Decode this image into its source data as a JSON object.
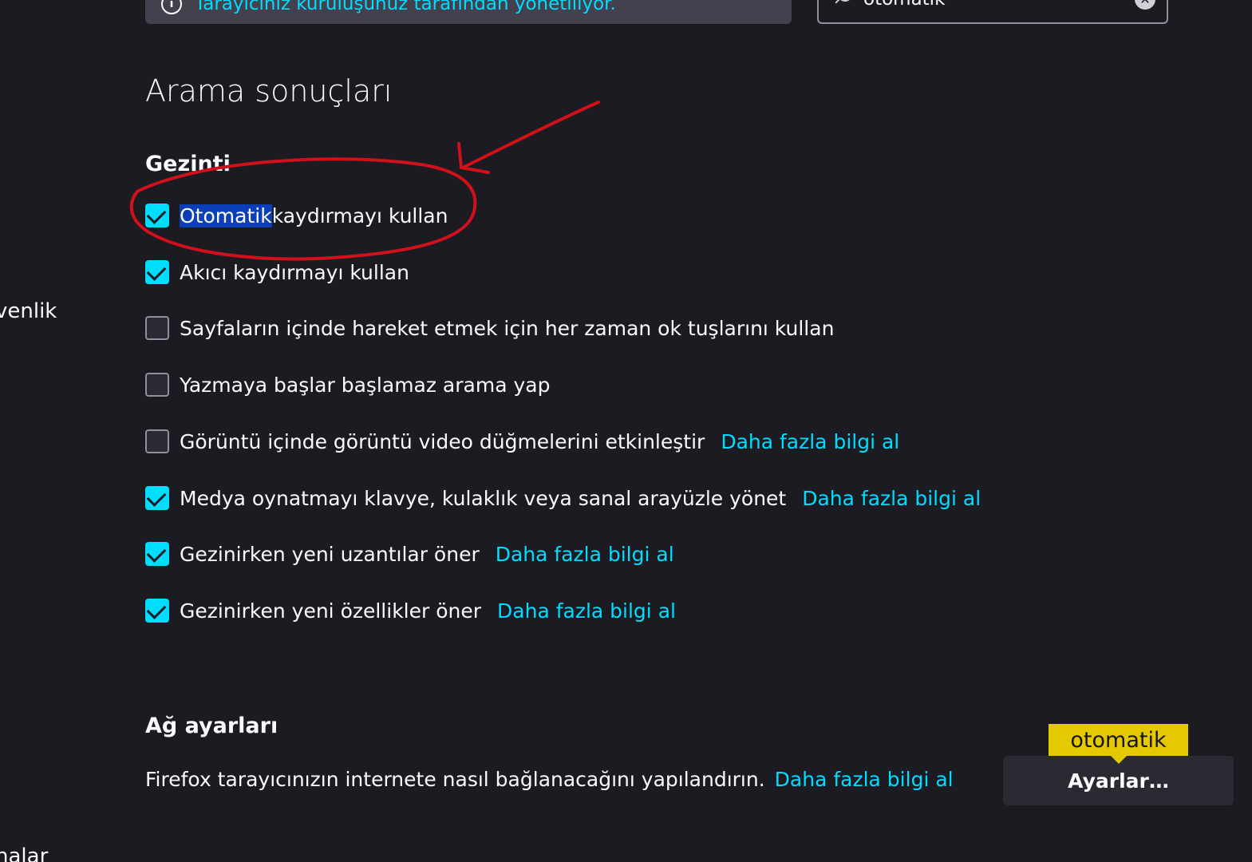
{
  "notice": {
    "text": "Tarayıcınız kuruluşunuz tarafından yönetiliyor."
  },
  "search": {
    "value": "otomatik"
  },
  "sidebar": {
    "item_partial_1": "venlik",
    "item_partial_2": "nalar"
  },
  "results_title": "Arama sonuçları",
  "browsing": {
    "title": "Gezinti",
    "options": [
      {
        "label_highlight": "Otomatik",
        "label_rest": " kaydırmayı kullan",
        "checked": true
      },
      {
        "label": "Akıcı kaydırmayı kullan",
        "checked": true
      },
      {
        "label": "Sayfaların içinde hareket etmek için her zaman ok tuşlarını kullan",
        "checked": false
      },
      {
        "label": "Yazmaya başlar başlamaz arama yap",
        "checked": false
      },
      {
        "label": "Görüntü içinde görüntü video düğmelerini etkinleştir",
        "checked": false,
        "link": "Daha fazla bilgi al"
      },
      {
        "label": "Medya oynatmayı klavye, kulaklık veya sanal arayüzle yönet",
        "checked": true,
        "link": "Daha fazla bilgi al"
      },
      {
        "label": "Gezinirken yeni uzantılar öner",
        "checked": true,
        "link": "Daha fazla bilgi al"
      },
      {
        "label": "Gezinirken yeni özellikler öner",
        "checked": true,
        "link": "Daha fazla bilgi al"
      }
    ]
  },
  "network": {
    "title": "Ağ ayarları",
    "description": "Firefox tarayıcınızın internete nasıl bağlanacağını yapılandırın.",
    "link": "Daha fazla bilgi al",
    "button": "Ayarlar…",
    "tooltip": "otomatik"
  },
  "colors": {
    "background": "#1c1b22",
    "accent": "#00ddff",
    "highlight": "#0a3fb8",
    "tooltip": "#e5c900",
    "annotation": "#d0101a"
  }
}
